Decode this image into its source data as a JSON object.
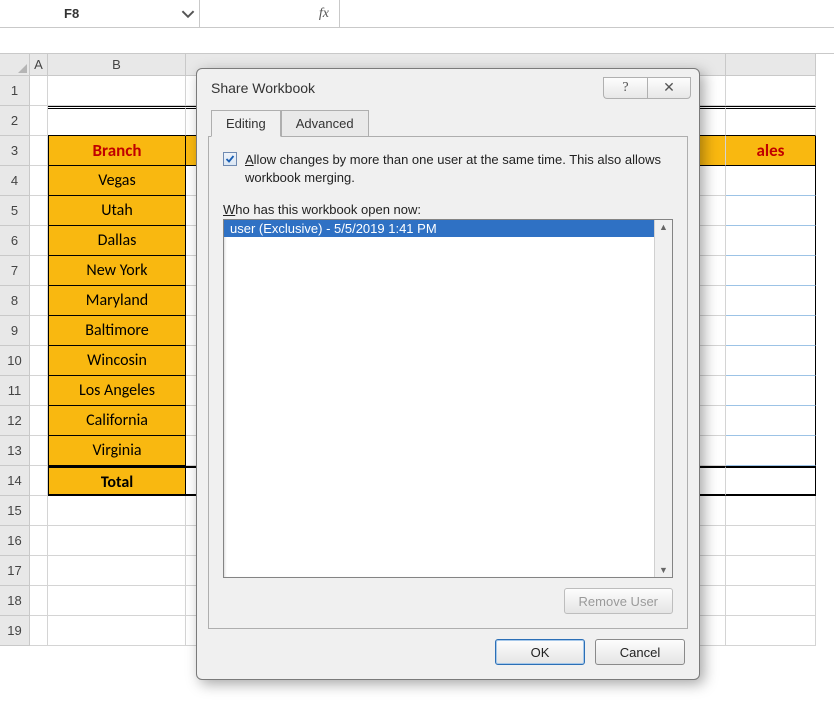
{
  "formula_bar": {
    "cell_ref": "F8",
    "fx_label": "fx",
    "formula": ""
  },
  "columns": {
    "A": "A",
    "B": "B",
    "last_label": "ales"
  },
  "rows": [
    "1",
    "2",
    "3",
    "4",
    "5",
    "6",
    "7",
    "8",
    "9",
    "10",
    "11",
    "12",
    "13",
    "14",
    "15",
    "16",
    "17",
    "18",
    "19"
  ],
  "table": {
    "header": "Branch",
    "items": [
      "Vegas",
      "Utah",
      "Dallas",
      "New York",
      "Maryland",
      "Baltimore",
      "Wincosin",
      "Los Angeles",
      "California",
      "Virginia"
    ],
    "total_label": "Total"
  },
  "dialog": {
    "title": "Share Workbook",
    "tabs": {
      "editing": "Editing",
      "advanced": "Advanced"
    },
    "allow_prefix": "A",
    "allow_rest": "llow changes by more than one user at the same time.  This also allows workbook merging.",
    "who_prefix": "W",
    "who_rest": "ho has this workbook open now:",
    "users": [
      "user (Exclusive) - 5/5/2019 1:41 PM"
    ],
    "remove_user": "Remove User",
    "ok": "OK",
    "cancel": "Cancel",
    "help": "?",
    "close": "✕"
  }
}
